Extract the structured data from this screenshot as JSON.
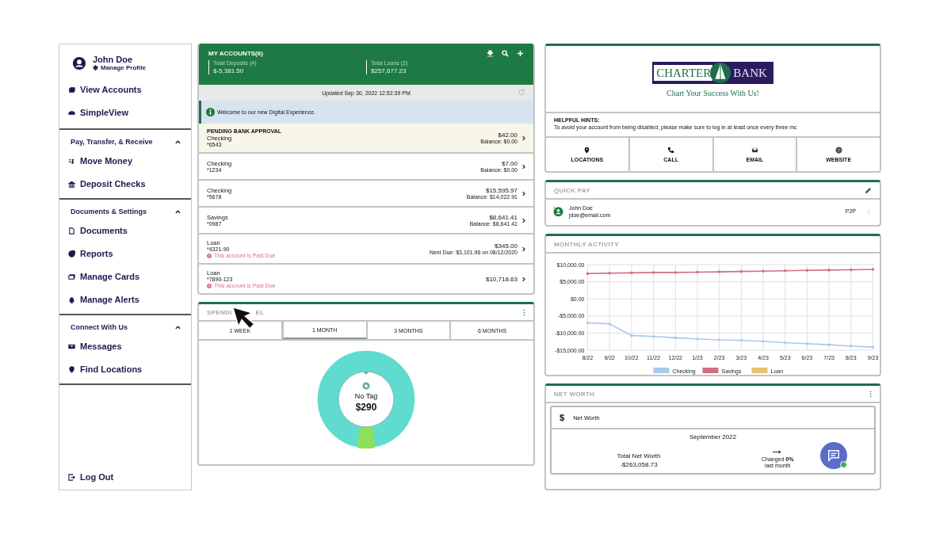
{
  "sidebar": {
    "profile": {
      "name": "John Doe",
      "link": "Manage Profile"
    },
    "sections": [
      {
        "items": [
          {
            "label": "View Accounts"
          },
          {
            "label": "SimpleView"
          }
        ]
      },
      {
        "heading": "Pay, Transfer, & Receive",
        "expanded": true,
        "items": [
          {
            "label": "Move Money"
          },
          {
            "label": "Deposit Checks"
          }
        ]
      },
      {
        "heading": "Documents & Settings",
        "expanded": true,
        "items": [
          {
            "label": "Documents"
          },
          {
            "label": "Reports"
          },
          {
            "label": "Manage Cards"
          },
          {
            "label": "Manage Alerts"
          }
        ]
      },
      {
        "heading": "Connect With Us",
        "expanded": true,
        "items": [
          {
            "label": "Messages"
          },
          {
            "label": "Find Locations"
          }
        ]
      }
    ],
    "logout": "Log Out"
  },
  "accounts": {
    "title": "MY ACCOUNTS(6)",
    "totals": [
      {
        "label": "Total Deposits (4)",
        "value": "$-5,381.50"
      },
      {
        "label": "Total Loans (2)",
        "value": "$257,677.23"
      }
    ],
    "updated": "Updated Sep 30, 2022 12:52:39 PM",
    "notice": "Welcome to our new Digital Experience.",
    "rows": [
      {
        "status": "PENDING BANK APPROVAL",
        "pending": true,
        "name": "Checking",
        "number": "*6543",
        "amount": "$42.00",
        "detail": "Balance: $0.00"
      },
      {
        "pending": false,
        "name": "Checking",
        "number": "*1234",
        "amount": "$7.00",
        "detail": "Balance: $0.00"
      },
      {
        "pending": false,
        "name": "Checking",
        "number": "*5678",
        "amount": "$15,595.97",
        "detail": "Balance: $14,022.91"
      },
      {
        "pending": false,
        "name": "Savings",
        "number": "*0987",
        "amount": "$8,641.41",
        "detail": "Balance: $8,641.41"
      },
      {
        "pending": false,
        "name": "Loan",
        "number": "*4321-90",
        "amount": "$345.00",
        "detail": "Next Due: $3,101.96 on 08/12/2020",
        "alert": "This account is Past Due"
      },
      {
        "pending": false,
        "name": "Loan",
        "number": "*7890-123",
        "amount": "$10,718.63",
        "alert": "This account is Past Due"
      }
    ]
  },
  "spending": {
    "title_parts": [
      "SPENDI",
      "EL"
    ],
    "tabs": [
      {
        "label": "1 WEEK",
        "selected": false
      },
      {
        "label": "1 MONTH",
        "selected": true
      },
      {
        "label": "3 MONTHS",
        "selected": false
      },
      {
        "label": "6 MONTHS",
        "selected": false
      }
    ],
    "center": {
      "label": "No Tag",
      "value": "$290"
    }
  },
  "bank": {
    "logo_left": "CHARTER",
    "logo_right": "BANK",
    "tagline": "Chart Your Success With Us!",
    "hints_heading": "HELPFUL HINTS:",
    "hint": "To avoid your account from being disabled, please make sure to log in at least once every three mc",
    "links": [
      "LOCATIONS",
      "CALL",
      "EMAIL",
      "WEBSITE"
    ]
  },
  "quick_pay": {
    "title": "QUICK PAY",
    "payees": [
      {
        "name": "John Doe",
        "email": "jdoe@email.com",
        "method": "P2P"
      }
    ]
  },
  "monthly_activity": {
    "title": "MONTHLY ACTIVITY",
    "chart_data": {
      "type": "line",
      "categories": [
        "8/22",
        "9/22",
        "10/22",
        "11/22",
        "12/22",
        "1/23",
        "2/23",
        "3/23",
        "4/23",
        "5/23",
        "6/23",
        "7/23",
        "8/23",
        "9/23"
      ],
      "series": [
        {
          "name": "Checking",
          "color": "#a9c9ea",
          "values": [
            -7000,
            -7300,
            -10700,
            -11000,
            -11400,
            -11700,
            -12000,
            -12100,
            -12400,
            -12800,
            -13100,
            -13400,
            -13800,
            -14100
          ]
        },
        {
          "name": "Savings",
          "color": "#d0707e",
          "values": [
            7400,
            7500,
            7600,
            7700,
            7700,
            7800,
            7900,
            8000,
            8100,
            8200,
            8300,
            8400,
            8500,
            8600
          ]
        },
        {
          "name": "Loan",
          "color": "#e6c46e",
          "values": [
            null,
            null,
            null,
            null,
            null,
            null,
            null,
            null,
            null,
            null,
            null,
            null,
            null,
            null
          ]
        }
      ],
      "ylim": [
        -15000,
        10000
      ],
      "grid": true,
      "legend": true,
      "yticks": [
        {
          "value": 10000,
          "label": "$10,000.00"
        },
        {
          "value": 5000,
          "label": "$5,000.00"
        },
        {
          "value": 0,
          "label": "$0.00"
        },
        {
          "value": -5000,
          "label": "-$5,000.00"
        },
        {
          "value": -10000,
          "label": "-$10,000.00"
        },
        {
          "value": -15000,
          "label": "-$15,000.00"
        }
      ]
    }
  },
  "net_worth": {
    "title": "NET WORTH",
    "card_icon": "$",
    "card_title": "Net Worth",
    "period": "September 2022",
    "total_label": "Total Net Worth",
    "total": "-$263,058.73",
    "change": "Changed **0%**",
    "change_period": "last month"
  }
}
